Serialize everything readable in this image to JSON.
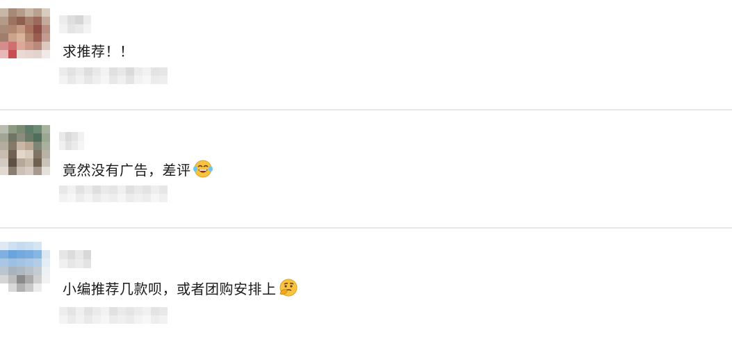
{
  "comments": [
    {
      "text": "求推荐！！",
      "emoji": ""
    },
    {
      "text": "竟然没有广告，差评",
      "emoji": "laughing-crying-emoji"
    },
    {
      "text": "小编推荐几款呗，或者团购安排上",
      "emoji": "thinking-emoji"
    }
  ],
  "colors": {
    "divider": "#e6e6e6",
    "text": "#1a1a1a",
    "blur_light": "#ededed",
    "blur_mid": "#dcdcdc"
  }
}
